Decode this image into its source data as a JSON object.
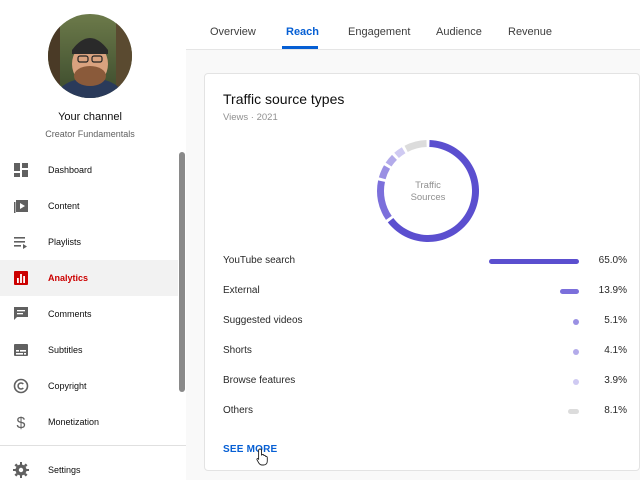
{
  "sidebar": {
    "channel_name": "Your channel",
    "channel_subtitle": "Creator Fundamentals",
    "items": [
      {
        "label": "Dashboard",
        "icon": "dashboard-icon"
      },
      {
        "label": "Content",
        "icon": "content-icon"
      },
      {
        "label": "Playlists",
        "icon": "playlists-icon"
      },
      {
        "label": "Analytics",
        "icon": "analytics-icon",
        "active": true
      },
      {
        "label": "Comments",
        "icon": "comments-icon"
      },
      {
        "label": "Subtitles",
        "icon": "subtitles-icon"
      },
      {
        "label": "Copyright",
        "icon": "copyright-icon"
      },
      {
        "label": "Monetization",
        "icon": "monetization-icon"
      },
      {
        "label": "Settings",
        "icon": "settings-icon"
      }
    ]
  },
  "tabs": [
    {
      "label": "Overview"
    },
    {
      "label": "Reach",
      "active": true
    },
    {
      "label": "Engagement"
    },
    {
      "label": "Audience"
    },
    {
      "label": "Revenue"
    }
  ],
  "card": {
    "title": "Traffic source types",
    "subtitle": "Views · 2021",
    "donut_label_line1": "Traffic",
    "donut_label_line2": "Sources",
    "rows": [
      {
        "label": "YouTube search",
        "value": "65.0%",
        "share": 0.65,
        "color": "#5b4fcf"
      },
      {
        "label": "External",
        "value": "13.9%",
        "share": 0.139,
        "color": "#7b6fdb"
      },
      {
        "label": "Suggested videos",
        "value": "5.1%",
        "share": 0.051,
        "color": "#9a90e3"
      },
      {
        "label": "Shorts",
        "value": "4.1%",
        "share": 0.041,
        "color": "#b3abea"
      },
      {
        "label": "Browse features",
        "value": "3.9%",
        "share": 0.039,
        "color": "#cfcaf2"
      },
      {
        "label": "Others",
        "value": "8.1%",
        "share": 0.081,
        "color": "#dcdcdc"
      }
    ],
    "see_more": "SEE MORE"
  },
  "colors": {
    "accent": "#065fd4",
    "active_nav": "#cc0000",
    "primary_series": "#5b4fcf"
  }
}
